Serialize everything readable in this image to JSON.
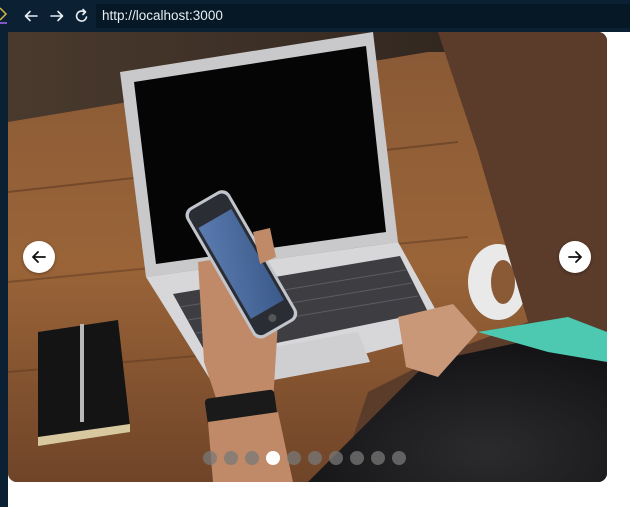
{
  "browser": {
    "url": "http://localhost:3000",
    "colors": {
      "toolbar": "#0b2033",
      "url_field": "#061726",
      "text": "#e6edf3"
    }
  },
  "carousel": {
    "image_alt": "",
    "slide_count": 10,
    "active_index": 3,
    "prev_icon": "arrow-left-icon",
    "next_icon": "arrow-right-icon"
  }
}
